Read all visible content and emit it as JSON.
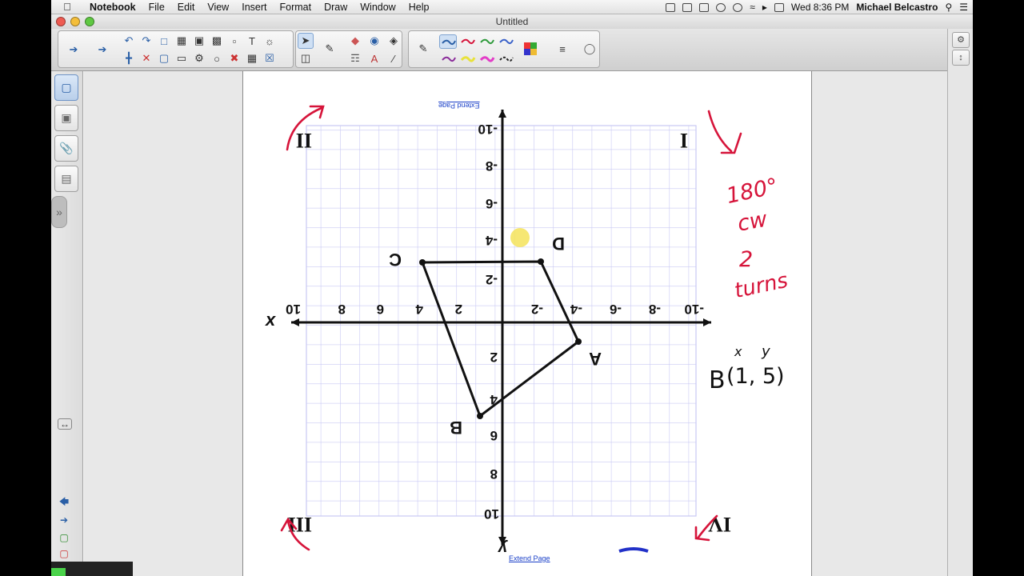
{
  "menubar": {
    "app_name": "Notebook",
    "menus": [
      "File",
      "Edit",
      "View",
      "Insert",
      "Format",
      "Draw",
      "Window",
      "Help"
    ],
    "clock": "Wed 8:36 PM",
    "user": "Michael Belcastro"
  },
  "window": {
    "title": "Untitled"
  },
  "page": {
    "extend_top": "Extend Page",
    "extend_bottom": "Extend Page"
  },
  "graph": {
    "x_axis_label": "x",
    "y_axis_label": "y",
    "x_ticks": [
      "10",
      "8",
      "6",
      "4",
      "2",
      "-2",
      "-4",
      "-6",
      "-8",
      "-10"
    ],
    "y_ticks_top": [
      "-10",
      "-8",
      "-6",
      "-4",
      "-2"
    ],
    "y_ticks_bottom": [
      "2",
      "4",
      "6",
      "8",
      "10"
    ],
    "quadrants": [
      "II",
      "I",
      "III",
      "IV"
    ],
    "vertices": [
      "A",
      "B",
      "C",
      "D"
    ]
  },
  "annotations": {
    "rotation": "180°",
    "direction": "cw",
    "turns_count": "2",
    "turns_word": "turns",
    "point_label": "B",
    "point_coords": "(1, 5)",
    "coord_x": "x",
    "coord_y": "y"
  },
  "colors": {
    "ink_red": "#d6143a",
    "grid": "#c9c9f4",
    "highlight": "#f5e35a",
    "link": "#1a40c8"
  }
}
